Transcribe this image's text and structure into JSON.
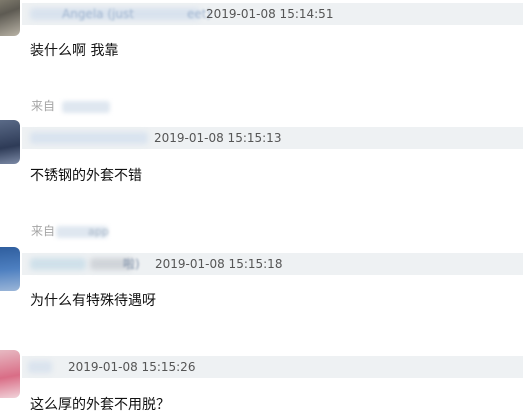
{
  "comments": [
    {
      "name": "Angela (just",
      "name_suffix": "eet)",
      "time": "2019-01-08 15:14:51",
      "text": "装什么啊 我靠",
      "source_label": "来自"
    },
    {
      "time": "2019-01-08 15:15:13",
      "text": "不锈钢的外套不错",
      "source_label": "来自",
      "source_name": "app"
    },
    {
      "name_suffix": "啦)",
      "time": "2019-01-08 15:15:18",
      "text": "为什么有特殊待遇呀"
    },
    {
      "time": "2019-01-08 15:15:26",
      "text": "这么厚的外套不用脱？"
    }
  ],
  "colors": {
    "header_bg": "#eef1f3",
    "name_link": "#9fb4cf",
    "time_text": "#555555",
    "body_text": "#111111",
    "source_text": "#a5a5a5"
  }
}
